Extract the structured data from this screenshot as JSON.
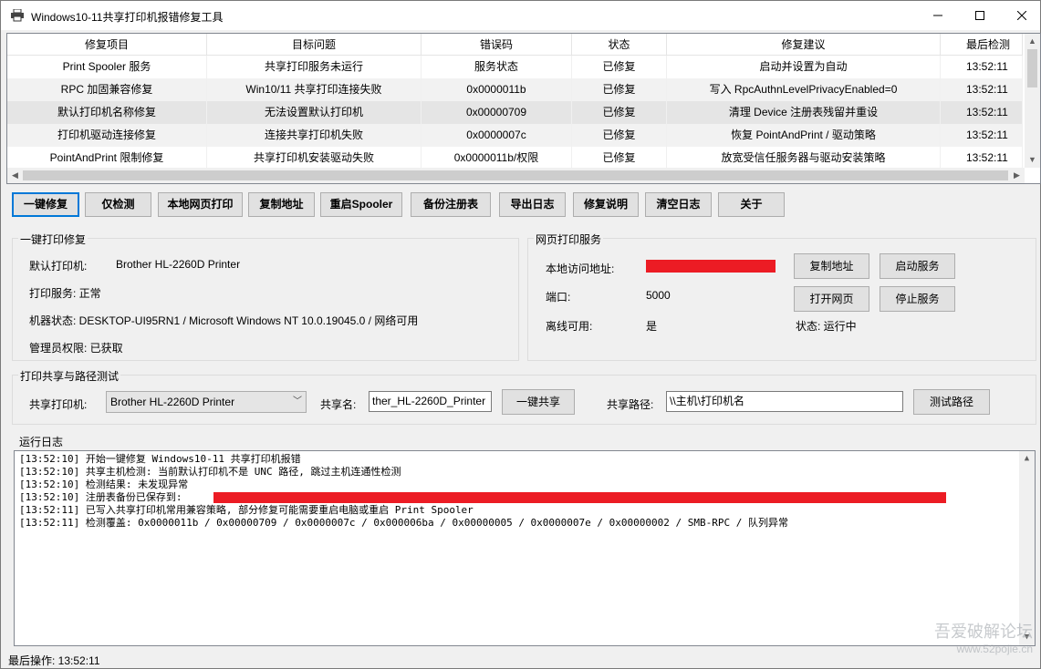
{
  "window": {
    "title": "Windows10-11共享打印机报错修复工具"
  },
  "table": {
    "headers": [
      "修复项目",
      "目标问题",
      "错误码",
      "状态",
      "修复建议",
      "最后检测"
    ],
    "rows": [
      [
        "Print Spooler 服务",
        "共享打印服务未运行",
        "服务状态",
        "已修复",
        "启动并设置为自动",
        "13:52:11"
      ],
      [
        "RPC 加固兼容修复",
        "Win10/11 共享打印连接失败",
        "0x0000011b",
        "已修复",
        "写入 RpcAuthnLevelPrivacyEnabled=0",
        "13:52:11"
      ],
      [
        "默认打印机名称修复",
        "无法设置默认打印机",
        "0x00000709",
        "已修复",
        "清理 Device 注册表残留并重设",
        "13:52:11"
      ],
      [
        "打印机驱动连接修复",
        "连接共享打印机失败",
        "0x0000007c",
        "已修复",
        "恢复 PointAndPrint / 驱动策略",
        "13:52:11"
      ],
      [
        "PointAndPrint 限制修复",
        "共享打印机安装驱动失败",
        "0x0000011b/权限",
        "已修复",
        "放宽受信任服务器与驱动安装策略",
        "13:52:11"
      ]
    ]
  },
  "toolbar": {
    "buttons": [
      "一键修复",
      "仅检测",
      "本地网页打印",
      "复制地址",
      "重启Spooler",
      "备份注册表",
      "导出日志",
      "修复说明",
      "清空日志",
      "关于"
    ]
  },
  "repair_group": {
    "title": "一键打印修复",
    "default_printer_label": "默认打印机:",
    "default_printer_value": "Brother HL-2260D Printer",
    "print_service": "打印服务: 正常",
    "machine_state": "机器状态: DESKTOP-UI95RN1 / Microsoft Windows NT 10.0.19045.0 / 网络可用",
    "admin": "管理员权限: 已获取"
  },
  "web_group": {
    "title": "网页打印服务",
    "local_addr_label": "本地访问地址:",
    "port_label": "端口:",
    "port_value": "5000",
    "offline_label": "离线可用:",
    "offline_value": "是",
    "copy_addr": "复制地址",
    "start_service": "启动服务",
    "open_web": "打开网页",
    "stop_service": "停止服务",
    "status": "状态: 运行中"
  },
  "share_group": {
    "title": "打印共享与路径测试",
    "printer_label": "共享打印机:",
    "printer_value": "Brother HL-2260D Printer",
    "share_name_label": "共享名:",
    "share_name_value": "ther_HL-2260D_Printer",
    "share_button": "一键共享",
    "path_label": "共享路径:",
    "path_value": "\\\\主机\\打印机名",
    "test_button": "测试路径"
  },
  "log": {
    "title": "运行日志",
    "lines": [
      "[13:52:10] 开始一键修复 Windows10-11 共享打印机报错",
      "[13:52:10] 共享主机检测: 当前默认打印机不是 UNC 路径, 跳过主机连通性检测",
      "[13:52:10] 检测结果: 未发现异常",
      "[13:52:10] 注册表备份已保存到:",
      "[13:52:11] 已写入共享打印机常用兼容策略, 部分修复可能需要重启电脑或重启 Print Spooler",
      "[13:52:11] 检测覆盖: 0x0000011b / 0x00000709 / 0x0000007c / 0x000006ba / 0x00000005 / 0x0000007e / 0x00000002 / SMB-RPC / 队列异常"
    ]
  },
  "status_bar": {
    "text": "最后操作: 13:52:11"
  },
  "watermark": {
    "line1": "吾爱破解论坛",
    "line2": "www.52pojie.cn"
  },
  "colors": {
    "accent": "#0078d7",
    "redaction": "#ec1c24"
  }
}
